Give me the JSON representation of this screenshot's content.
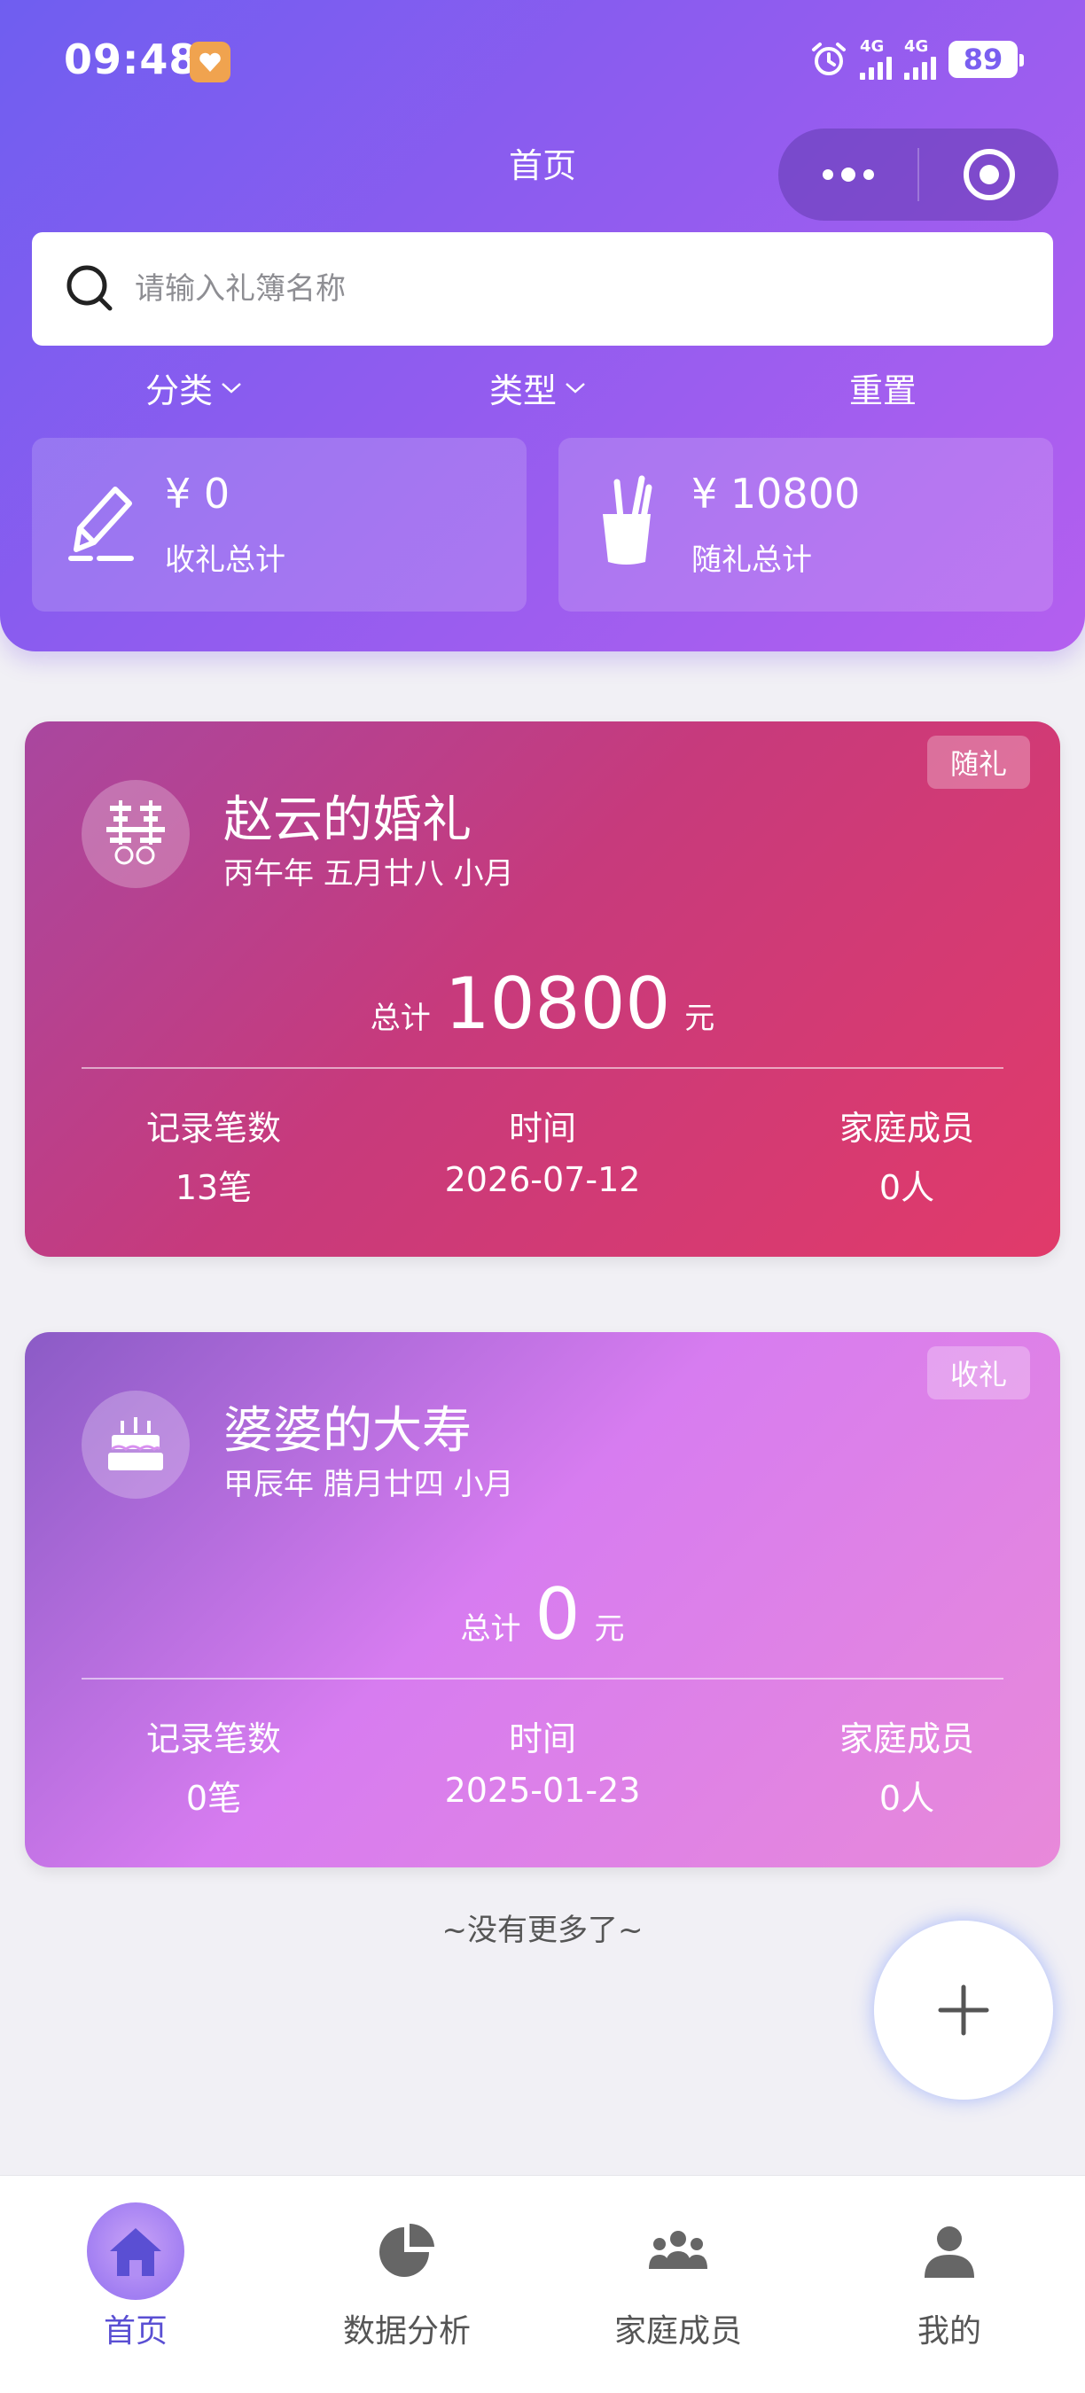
{
  "status_bar": {
    "time": "09:48",
    "network1": "4G",
    "network2": "4G",
    "battery": "89"
  },
  "header": {
    "title": "首页"
  },
  "search": {
    "placeholder": "请输入礼簿名称"
  },
  "filters": {
    "category": "分类",
    "type": "类型",
    "reset": "重置"
  },
  "summary": {
    "received": {
      "amount": "¥ 0",
      "label": "收礼总计",
      "icon": "pencil-icon"
    },
    "given": {
      "amount": "¥ 10800",
      "label": "随礼总计",
      "icon": "pen-holder-icon"
    }
  },
  "books": [
    {
      "tag": "随礼",
      "title": "赵云的婚礼",
      "lunar": "丙午年 五月廿八 小月",
      "total_prefix": "总计",
      "total": "10800",
      "total_unit": "元",
      "count_label": "记录笔数",
      "count": "13笔",
      "date_label": "时间",
      "date": "2026-07-12",
      "members_label": "家庭成员",
      "members": "0人",
      "icon": "double-happiness-icon"
    },
    {
      "tag": "收礼",
      "title": "婆婆的大寿",
      "lunar": "甲辰年 腊月廿四 小月",
      "total_prefix": "总计",
      "total": "0",
      "total_unit": "元",
      "count_label": "记录笔数",
      "count": "0笔",
      "date_label": "时间",
      "date": "2025-01-23",
      "members_label": "家庭成员",
      "members": "0人",
      "icon": "birthday-cake-icon"
    }
  ],
  "list_end": "~没有更多了~",
  "tabbar": [
    {
      "label": "首页",
      "icon": "home-icon",
      "active": true
    },
    {
      "label": "数据分析",
      "icon": "pie-chart-icon",
      "active": false
    },
    {
      "label": "家庭成员",
      "icon": "group-icon",
      "active": false
    },
    {
      "label": "我的",
      "icon": "person-icon",
      "active": false
    }
  ],
  "colors": {
    "header_start": "#6f5ef0",
    "header_end": "#b45fef",
    "active_tab": "#5a4fd3"
  }
}
